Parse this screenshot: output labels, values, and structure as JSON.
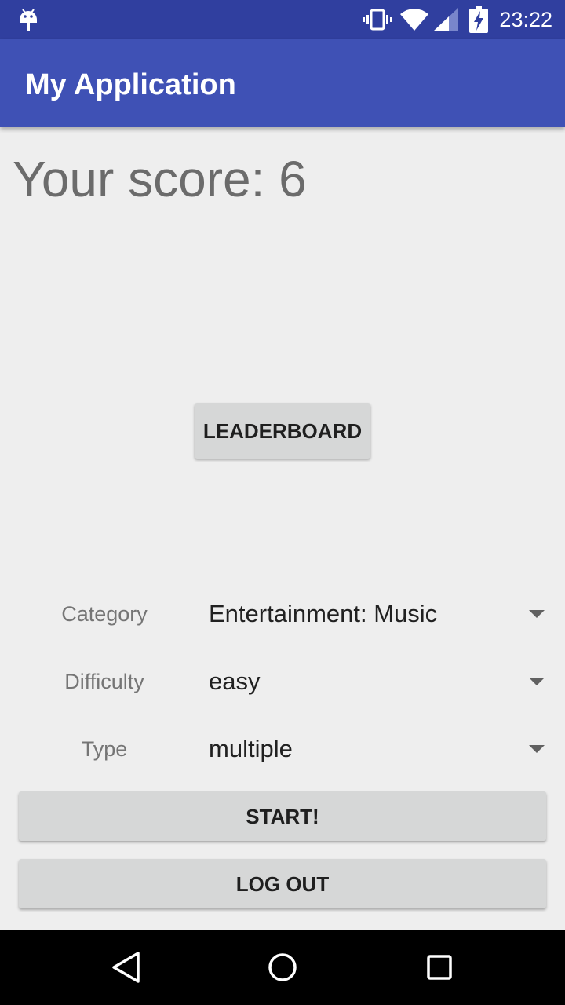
{
  "status_bar": {
    "time": "23:22",
    "icons": [
      "android-icon",
      "vibrate-icon",
      "wifi-icon",
      "signal-icon",
      "battery-charging-icon"
    ]
  },
  "app_bar": {
    "title": "My Application"
  },
  "main": {
    "score_text": "Your score: 6",
    "leaderboard_label": "LEADERBOARD",
    "form": {
      "category": {
        "label": "Category",
        "value": "Entertainment: Music"
      },
      "difficulty": {
        "label": "Difficulty",
        "value": "easy"
      },
      "type": {
        "label": "Type",
        "value": "multiple"
      }
    },
    "start_label": "START!",
    "logout_label": "LOG OUT"
  },
  "nav_bar": {
    "buttons": [
      "back-icon",
      "home-icon",
      "recents-icon"
    ]
  },
  "colors": {
    "status_bar": "#303f9f",
    "app_bar": "#3f51b5",
    "background": "#eeeeee",
    "button": "#d6d7d7",
    "nav_bar": "#000000"
  }
}
